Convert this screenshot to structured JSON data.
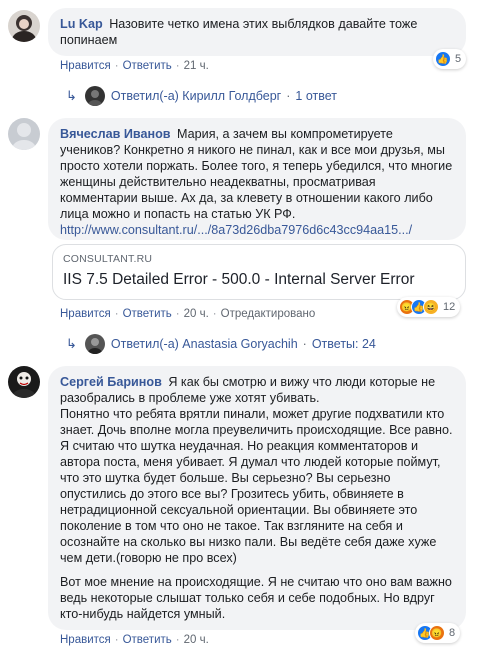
{
  "comments": [
    {
      "author": "Lu Kap",
      "text": "Назовите четко имена этих выблядков давайте тоже попинаем",
      "actions": {
        "like": "Нравится",
        "reply": "Ответить",
        "time": "21 ч."
      },
      "reaction_count": "5",
      "replies": {
        "who": "Ответил(-а) Кирилл Голдберг",
        "count": "1 ответ"
      }
    },
    {
      "author": "Вячеслав Иванов",
      "text": "Мария, а зачем вы компрометируете учеников? Конкретно я никого не пинал, как и все мои друзья, мы просто хотели поржать. Более того, я теперь убедился, что многие женщины действительно неадекватны, просматривая комментарии выше. Ах да, за клевету в отношении какого либо лица можно и попасть на статью УК РФ.",
      "url": "http://www.consultant.ru/.../8a73d26dba7976d6c43cc94aa15.../",
      "preview": {
        "domain": "CONSULTANT.RU",
        "title": "IIS 7.5 Detailed Error - 500.0 - Internal Server Error"
      },
      "actions": {
        "like": "Нравится",
        "reply": "Ответить",
        "time": "20 ч.",
        "edited": "Отредактировано"
      },
      "reaction_count": "12",
      "replies": {
        "who": "Ответил(-а) Anastasia Goryachih",
        "count": "Ответы: 24"
      }
    },
    {
      "author": "Сергей Баринов",
      "text_p1": "Я как бы смотрю и вижу что люди которые не разобрались в проблеме уже хотят убивать.",
      "text_p2": "Понятно что ребята врятли пинали, может другие подхватили кто знает. Дочь вполне могла преувеличить происходящие. Все равно. Я считаю что шутка неудачная. Но реакция комментаторов и автора поста, меня убивает. Я думал что людей которые поймут, что это шутка будет больше. Вы серьезно? Вы серьезно опустились до этого все вы? Грозитесь убить, обвиняете в нетрадиционной сексуальной ориентации. Вы обвиняете это поколение в том что оно не такое. Так взгляните на себя и осознайте на сколько вы низко пали. Вы ведёте себя даже хуже чем дети.(говорю не про всех)",
      "text_p3": "Вот мое мнение на происходящие. Я не считаю что оно вам важно ведь некоторые слышат только себя и себе подобных. Но вдруг кто-нибудь найдется умный.",
      "actions": {
        "like": "Нравится",
        "reply": "Ответить",
        "time": "20 ч."
      },
      "reaction_count": "8"
    }
  ],
  "icons": {
    "like": "like-icon",
    "angry": "angry-icon",
    "haha": "haha-icon",
    "reply_arrow": "reply-arrow-icon"
  },
  "colors": {
    "link": "#385898",
    "bubble": "#f2f3f5",
    "like": "#1877f2"
  }
}
